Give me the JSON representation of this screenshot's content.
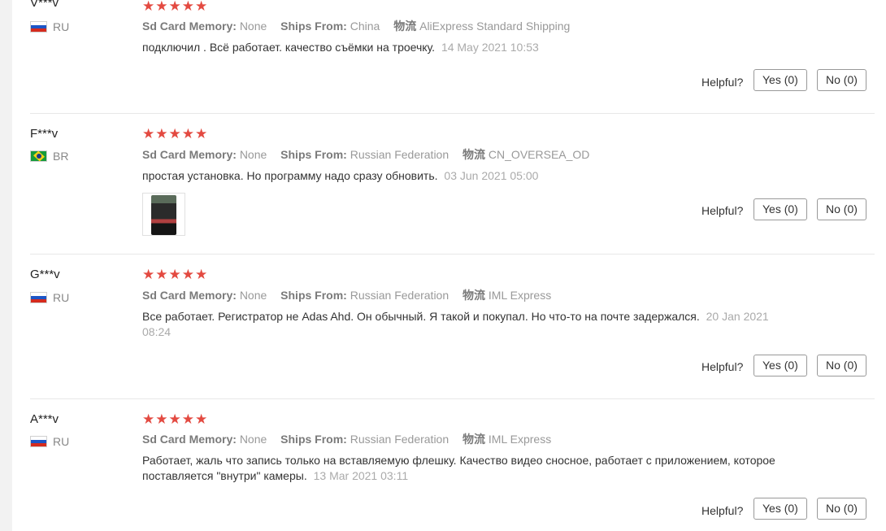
{
  "helpful_label": "Helpful?",
  "labels": {
    "sd_card": "Sd Card Memory:",
    "ships_from": "Ships From:",
    "shipping": "物流"
  },
  "rating_stars": "★★★★★",
  "reviews": [
    {
      "user": "V***v",
      "country": "RU",
      "sd_card": "None",
      "ships_from": "China",
      "shipping": "AliExpress Standard Shipping",
      "text": "подключил . Всё работает. качество съёмки на троечку.",
      "date": "14 May 2021 10:53",
      "yes": "Yes (0)",
      "no": "No (0)"
    },
    {
      "user": "F***v",
      "country": "BR",
      "sd_card": "None",
      "ships_from": "Russian Federation",
      "shipping": "CN_OVERSEA_OD",
      "text": "простая установка. Но программу надо сразу обновить.",
      "date": "03 Jun 2021 05:00",
      "yes": "Yes (0)",
      "no": "No (0)"
    },
    {
      "user": "G***v",
      "country": "RU",
      "sd_card": "None",
      "ships_from": "Russian Federation",
      "shipping": "IML Express",
      "text": "Все работает. Регистратор не Adas Ahd. Он обычный. Я такой и покупал. Но что-то на почте задержался.",
      "date": "20 Jan 2021 08:24",
      "yes": "Yes (0)",
      "no": "No (0)"
    },
    {
      "user": "A***v",
      "country": "RU",
      "sd_card": "None",
      "ships_from": "Russian Federation",
      "shipping": "IML Express",
      "text": "Работает, жаль что запись только на вставляемую флешку. Качество видео сносное, работает с приложением, которое поставляется \"внутри\" камеры.",
      "date": "13 Mar 2021 03:11",
      "yes": "Yes (0)",
      "no": "No (0)"
    }
  ]
}
